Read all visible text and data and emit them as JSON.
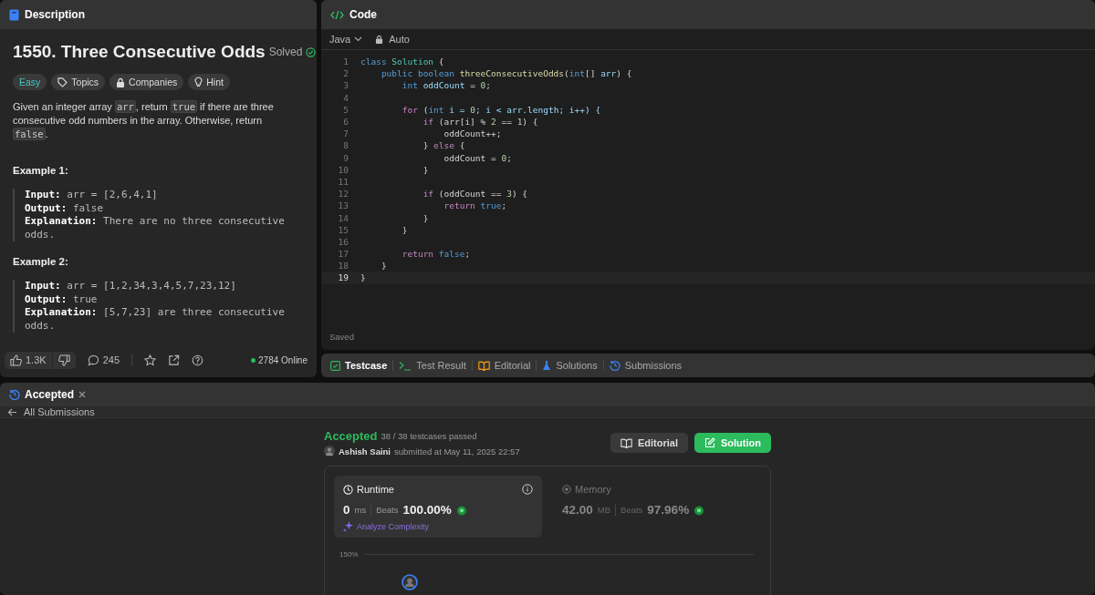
{
  "description_panel": {
    "tab": "Description",
    "title": "1550. Three Consecutive Odds",
    "status": "Solved",
    "tags": [
      {
        "kind": "difficulty",
        "label": "Easy"
      },
      {
        "kind": "topics",
        "label": "Topics"
      },
      {
        "kind": "companies",
        "label": "Companies"
      },
      {
        "kind": "hint",
        "label": "Hint"
      }
    ],
    "paragraph": [
      {
        "text": "Given an integer array ",
        "code": false
      },
      {
        "text": "arr",
        "code": true
      },
      {
        "text": ", return ",
        "code": false
      },
      {
        "text": "true",
        "code": true
      },
      {
        "text": " if there are three consecutive odd numbers in the array. Otherwise, return ",
        "code": false
      },
      {
        "text": "false",
        "code": true
      },
      {
        "text": ".",
        "code": false
      }
    ],
    "examples": [
      {
        "title": "Example 1:",
        "lines": [
          "**Input:** arr = [2,6,4,1]",
          "**Output:** false",
          "**Explanation:** There are no three consecutive odds."
        ]
      },
      {
        "title": "Example 2:",
        "lines": [
          "**Input:** arr = [1,2,34,3,4,5,7,23,12]",
          "**Output:** true",
          "**Explanation:** [5,7,23] are three consecutive odds."
        ]
      }
    ],
    "footer": {
      "likes": "1.3K",
      "comments": "245",
      "online": "2784 Online"
    }
  },
  "code_panel": {
    "tab": "Code",
    "language": "Java",
    "mode": "Auto",
    "saved": "Saved",
    "lines": [
      {
        "number": "1",
        "tokens": [
          {
            "text": "class ",
            "kind": "kw"
          },
          {
            "text": "Solution",
            "kind": "type"
          },
          {
            "text": " {",
            "kind": "p"
          }
        ]
      },
      {
        "number": "2",
        "tokens": [
          {
            "text": "    public boolean ",
            "kind": "kw"
          },
          {
            "text": "threeConsecutiveOdds",
            "kind": "fn"
          },
          {
            "text": "(",
            "kind": "p"
          },
          {
            "text": "int",
            "kind": "kw"
          },
          {
            "text": "[] ",
            "kind": "p"
          },
          {
            "text": "arr",
            "kind": "var"
          },
          {
            "text": ") {",
            "kind": "p"
          }
        ]
      },
      {
        "number": "3",
        "tokens": [
          {
            "text": "        int ",
            "kind": "kw"
          },
          {
            "text": "oddCount",
            "kind": "var"
          },
          {
            "text": " = ",
            "kind": "p"
          },
          {
            "text": "0",
            "kind": "num"
          },
          {
            "text": ";",
            "kind": "p"
          }
        ]
      },
      {
        "number": "4"
      },
      {
        "number": "5",
        "tokens": [
          {
            "text": "        for ",
            "kind": "ctl"
          },
          {
            "text": "(",
            "kind": "p"
          },
          {
            "text": "int ",
            "kind": "kw"
          },
          {
            "text": "i = ",
            "kind": "var"
          },
          {
            "text": "0",
            "kind": "num"
          },
          {
            "text": "; i < arr.length; i++) {",
            "kind": "var"
          }
        ]
      },
      {
        "number": "6",
        "tokens": [
          {
            "text": "            if ",
            "kind": "ctl"
          },
          {
            "text": "(arr[i] % ",
            "kind": "p"
          },
          {
            "text": "2",
            "kind": "num"
          },
          {
            "text": " == ",
            "kind": "p"
          },
          {
            "text": "1",
            "kind": "num"
          },
          {
            "text": ") {",
            "kind": "p"
          }
        ]
      },
      {
        "number": "7",
        "tokens": [
          {
            "text": "                oddCount++;",
            "kind": "p"
          }
        ]
      },
      {
        "number": "8",
        "tokens": [
          {
            "text": "            } ",
            "kind": "p"
          },
          {
            "text": "else",
            "kind": "ctl"
          },
          {
            "text": " {",
            "kind": "p"
          }
        ]
      },
      {
        "number": "9",
        "tokens": [
          {
            "text": "                oddCount = ",
            "kind": "p"
          },
          {
            "text": "0",
            "kind": "num"
          },
          {
            "text": ";",
            "kind": "p"
          }
        ]
      },
      {
        "number": "10",
        "tokens": [
          {
            "text": "            }",
            "kind": "p"
          }
        ]
      },
      {
        "number": "11"
      },
      {
        "number": "12",
        "tokens": [
          {
            "text": "            if ",
            "kind": "ctl"
          },
          {
            "text": "(oddCount == ",
            "kind": "p"
          },
          {
            "text": "3",
            "kind": "num"
          },
          {
            "text": ") {",
            "kind": "p"
          }
        ]
      },
      {
        "number": "13",
        "tokens": [
          {
            "text": "                return ",
            "kind": "ctl"
          },
          {
            "text": "true",
            "kind": "kw"
          },
          {
            "text": ";",
            "kind": "p"
          }
        ]
      },
      {
        "number": "14",
        "tokens": [
          {
            "text": "            }",
            "kind": "p"
          }
        ]
      },
      {
        "number": "15",
        "tokens": [
          {
            "text": "        }",
            "kind": "p"
          }
        ]
      },
      {
        "number": "16"
      },
      {
        "number": "17",
        "tokens": [
          {
            "text": "        return ",
            "kind": "ctl"
          },
          {
            "text": "false",
            "kind": "kw"
          },
          {
            "text": ";",
            "kind": "p"
          }
        ]
      },
      {
        "number": "18",
        "tokens": [
          {
            "text": "    }",
            "kind": "p"
          }
        ]
      },
      {
        "number": "19",
        "tokens": [
          {
            "text": "}",
            "kind": "p"
          }
        ]
      }
    ]
  },
  "bottom_tabs": [
    {
      "label": "Testcase",
      "kind": "testcase",
      "selected": true
    },
    {
      "label": "Test Result",
      "kind": "result",
      "selected": false
    },
    {
      "label": "Editorial",
      "kind": "editorial",
      "selected": false
    },
    {
      "label": "Solutions",
      "kind": "solutions",
      "selected": false
    },
    {
      "label": "Submissions",
      "kind": "submissions",
      "selected": false
    }
  ],
  "result_panel": {
    "tab": "Accepted",
    "back": "All Submissions",
    "status": "Accepted",
    "passed": "38 / 38 testcases passed",
    "user": "Ashish Saini",
    "submitted": "submitted at May 11, 2025 22:57",
    "buttons": [
      {
        "label": "Editorial",
        "kind": "secondary"
      },
      {
        "label": "Solution",
        "kind": "primary"
      }
    ],
    "metrics": [
      {
        "title": "Runtime",
        "kind": "runtime",
        "selected": true,
        "value": "0",
        "unit": "ms",
        "beats_label": "Beats",
        "beats": "100.00%",
        "analyze": "Analyze Complexity"
      },
      {
        "title": "Memory",
        "kind": "memory",
        "selected": false,
        "value": "42.00",
        "unit": "MB",
        "beats_label": "Beats",
        "beats": "97.96%"
      }
    ],
    "chart_tick": "150%"
  }
}
